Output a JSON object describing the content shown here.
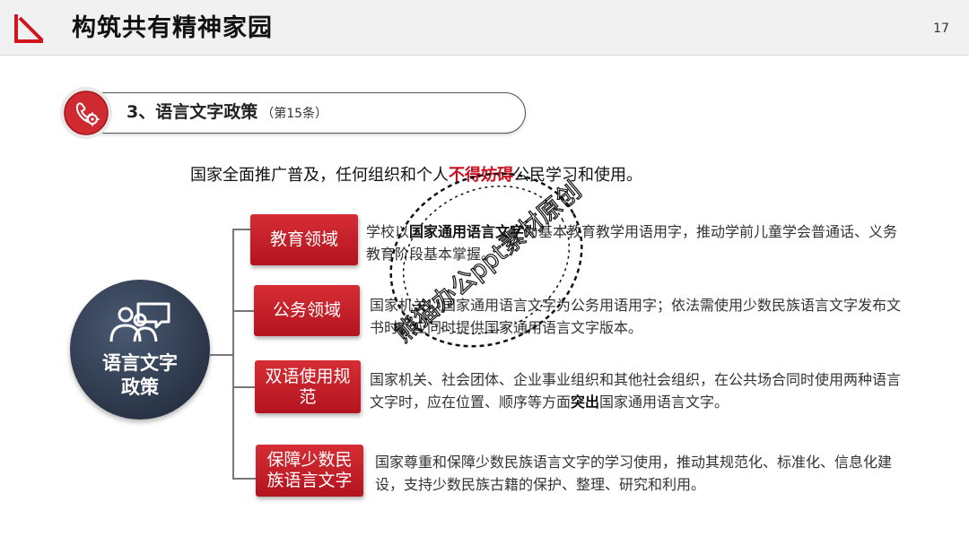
{
  "header": {
    "title": "构筑共有精神家园",
    "page_number": "17"
  },
  "section": {
    "title": "3、语言文字政策",
    "subtitle": "（第15条）"
  },
  "principle": {
    "before": "国家全面推广普及，任何组织和个人",
    "emphasis": "不得妨碍",
    "after": "公民学习和使用。"
  },
  "center": {
    "label": "语言文字政策",
    "icon": "people-speech-icon"
  },
  "items": [
    {
      "label": "教育领域",
      "desc": [
        {
          "t": "学校以",
          "b": false
        },
        {
          "t": "国家通用语言文字",
          "b": true
        },
        {
          "t": "为基本教育教学用语用字，推动学前儿童学会普通话、义务教育阶段基本掌握。",
          "b": false
        }
      ]
    },
    {
      "label": "公务领域",
      "desc": [
        {
          "t": "国家机关以国家通用语言文字为公务用语用字；依法需使用少数民族语言文字发布文书时，应同时提供国家通用语言文字版本。",
          "b": false
        }
      ]
    },
    {
      "label": "双语使用规范",
      "desc": [
        {
          "t": "国家机关、社会团体、企业事业组织和其他社会组织，在公共场合同时使用两种语言文字时，应在位置、顺序等方面",
          "b": false
        },
        {
          "t": "突出",
          "b": true
        },
        {
          "t": "国家通用语言文字。",
          "b": false
        }
      ]
    },
    {
      "label": "保障少数民族语言文字",
      "desc": [
        {
          "t": "国家尊重和保障少数民族语言文字的学习使用，推动其规范化、标准化、信息化建设，支持少数民族古籍的保护、整理、研究和利用。",
          "b": false
        }
      ]
    }
  ],
  "watermark": {
    "text": "熊猫办公ppt素材原创",
    "icon": "round-stamp-watermark"
  },
  "colors": {
    "accent_red": "#c8101e",
    "circle_navy": "#2a3547",
    "header_bg": "#f1f1f1"
  }
}
